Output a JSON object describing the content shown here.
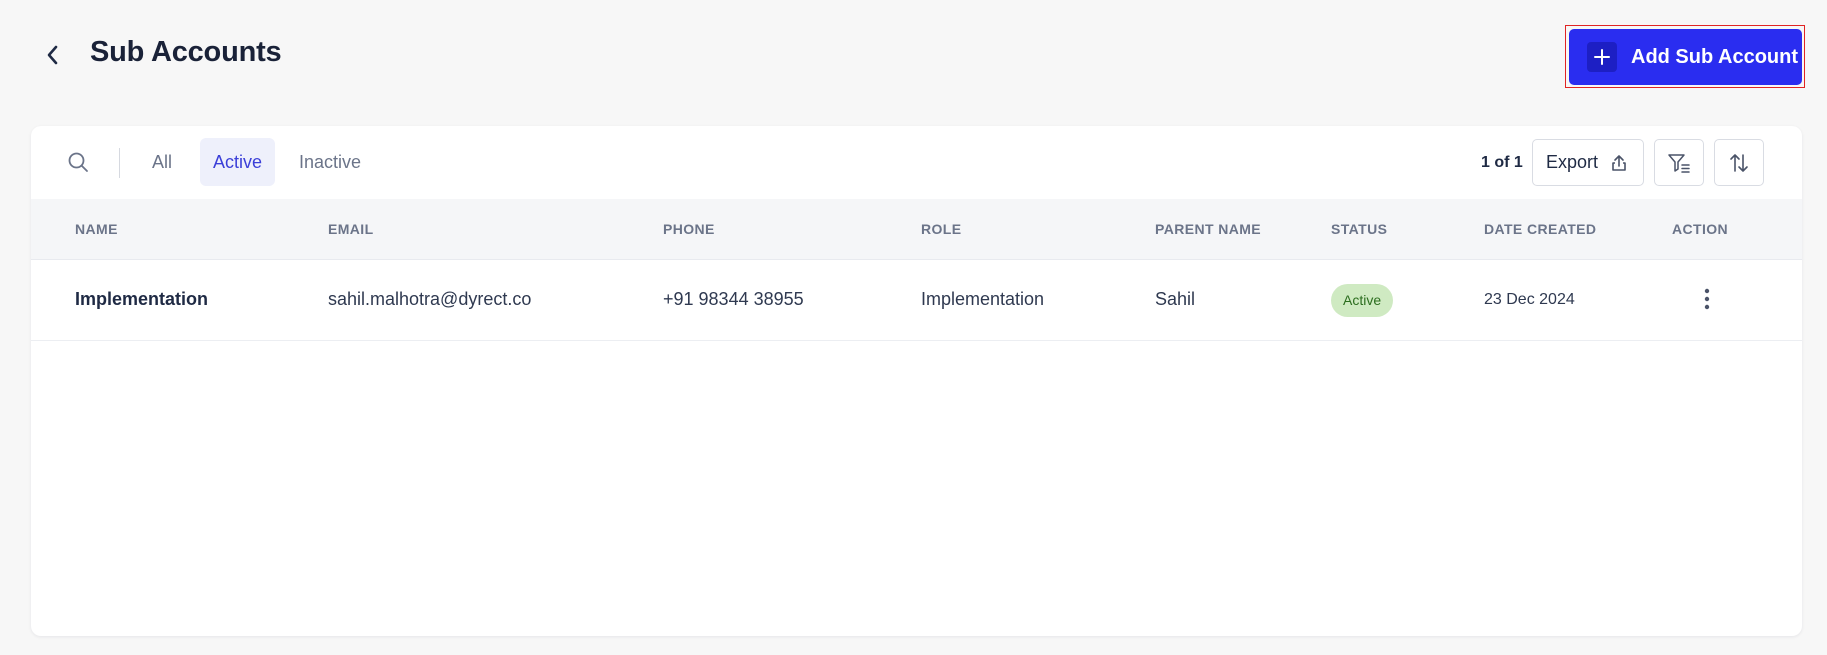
{
  "header": {
    "title": "Sub Accounts",
    "add_button_label": "Add Sub Account"
  },
  "toolbar": {
    "tabs": [
      {
        "label": "All"
      },
      {
        "label": "Active"
      },
      {
        "label": "Inactive"
      }
    ],
    "active_tab": "Active",
    "count_text": "1 of 1",
    "export_label": "Export"
  },
  "table": {
    "columns": [
      "NAME",
      "EMAIL",
      "PHONE",
      "ROLE",
      "PARENT NAME",
      "STATUS",
      "DATE CREATED",
      "ACTION"
    ],
    "rows": [
      {
        "name": "Implementation",
        "email": "sahil.malhotra@dyrect.co",
        "phone": "+91 98344 38955",
        "role": "Implementation",
        "parent_name": "Sahil",
        "status": "Active",
        "date_created": "23 Dec 2024"
      }
    ]
  },
  "colors": {
    "primary": "#2a2df0",
    "active_tab_text": "#3b3fd8",
    "status_active_bg": "#cfeac2",
    "highlight_outline": "#e02424"
  },
  "icons": [
    "chevron-left-icon",
    "plus-icon",
    "search-icon",
    "upload-icon",
    "filter-icon",
    "sort-icon",
    "more-vertical-icon"
  ]
}
